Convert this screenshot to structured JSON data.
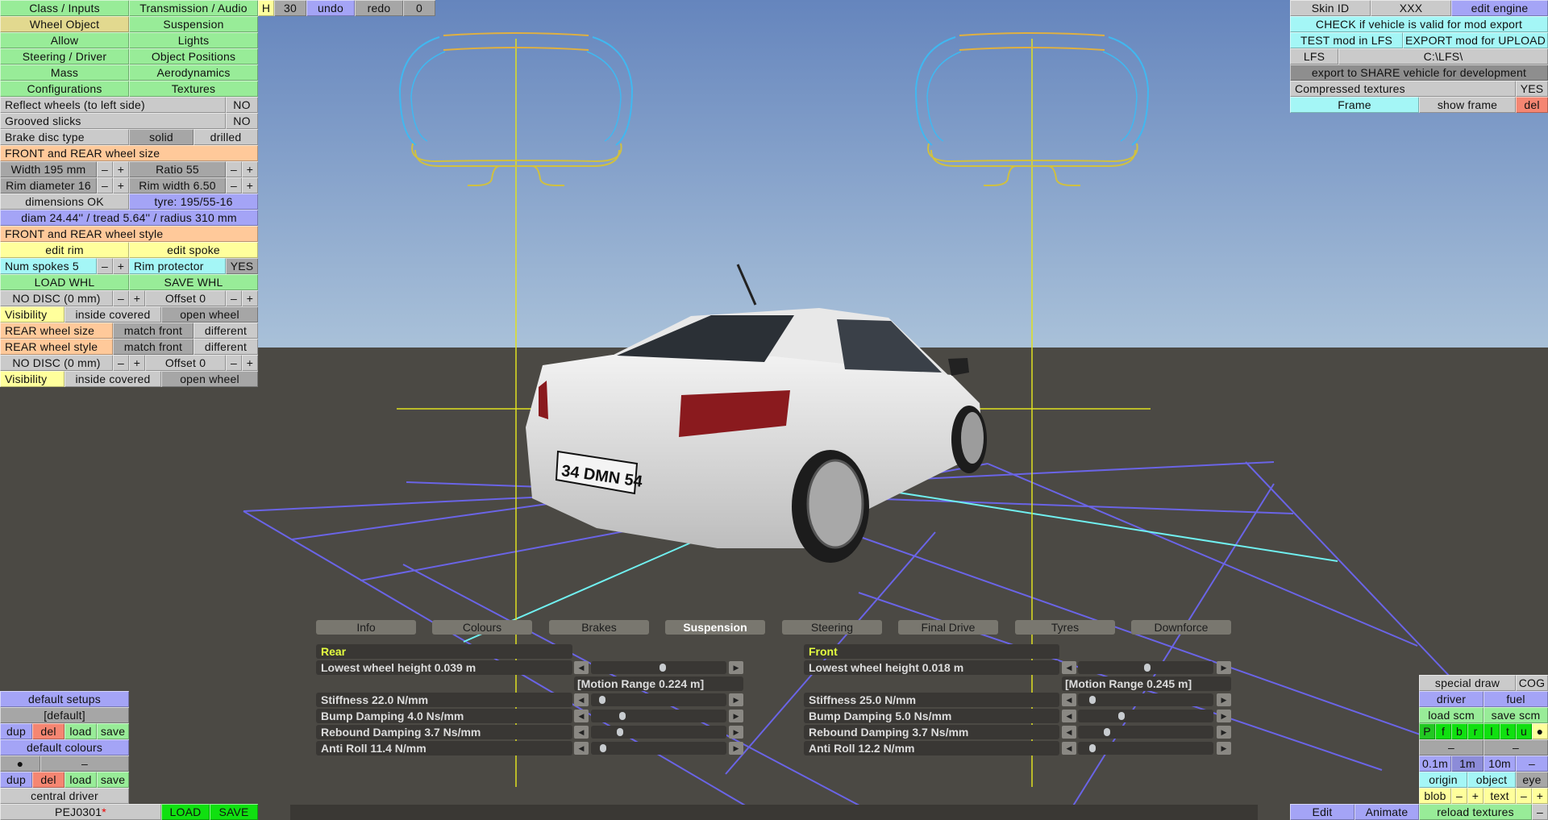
{
  "toolbar": {
    "h": "H",
    "count": "30",
    "undo": "undo",
    "redo": "redo",
    "zero": "0"
  },
  "left_panel": {
    "tabs": [
      "Class / Inputs",
      "Transmission / Audio",
      "Wheel Object",
      "Suspension",
      "Allow",
      "Lights",
      "Steering / Driver",
      "Object Positions",
      "Mass",
      "Aerodynamics",
      "Configurations",
      "Textures"
    ],
    "active_tab": "Wheel Object",
    "reflect": {
      "label": "Reflect wheels (to left side)",
      "value": "NO"
    },
    "grooved": {
      "label": "Grooved slicks",
      "value": "NO"
    },
    "brake_disc": {
      "label": "Brake disc type",
      "solid": "solid",
      "drilled": "drilled",
      "selected": "solid"
    },
    "size_header": "FRONT and REAR wheel size",
    "width": {
      "label": "Width 195 mm",
      "minus": "–",
      "plus": "+"
    },
    "ratio": {
      "label": "Ratio 55",
      "minus": "–",
      "plus": "+"
    },
    "rim_diameter": {
      "label": "Rim diameter 16",
      "minus": "–",
      "plus": "+"
    },
    "rim_width": {
      "label": "Rim width 6.50",
      "minus": "–",
      "plus": "+"
    },
    "dimensions": "dimensions OK",
    "tyre": "tyre: 195/55-16",
    "diam_info": "diam 24.44'' / tread 5.64'' / radius 310 mm",
    "style_header": "FRONT and REAR wheel style",
    "edit_rim": "edit rim",
    "edit_spoke": "edit spoke",
    "num_spokes": {
      "label": "Num spokes 5",
      "minus": "–",
      "plus": "+"
    },
    "rim_protector": {
      "label": "Rim protector",
      "value": "YES"
    },
    "load_whl": "LOAD WHL",
    "save_whl": "SAVE WHL",
    "front_disc": {
      "label": "NO DISC (0 mm)",
      "minus": "–",
      "plus": "+",
      "offset": "Offset 0",
      "offset_minus": "–",
      "offset_plus": "+"
    },
    "front_visibility": {
      "label": "Visibility",
      "inside": "inside covered",
      "open": "open wheel",
      "selected": "open wheel"
    },
    "rear_size": {
      "label": "REAR wheel size",
      "match": "match front",
      "different": "different",
      "selected": "match front"
    },
    "rear_style": {
      "label": "REAR wheel style",
      "match": "match front",
      "different": "different",
      "selected": "match front"
    },
    "rear_disc": {
      "label": "NO DISC (0 mm)",
      "minus": "–",
      "plus": "+",
      "offset": "Offset 0",
      "offset_minus": "–",
      "offset_plus": "+"
    },
    "rear_visibility": {
      "label": "Visibility",
      "inside": "inside covered",
      "open": "open wheel",
      "selected": "open wheel"
    }
  },
  "right_panel": {
    "skin_id": "Skin ID",
    "skin_value": "XXX",
    "edit_engine": "edit engine",
    "check": "CHECK if vehicle is valid for mod export",
    "test": "TEST mod in LFS",
    "export": "EXPORT mod for UPLOAD",
    "lfs": "LFS",
    "path": "C:\\LFS\\",
    "share": "export to SHARE vehicle for development",
    "compressed": {
      "label": "Compressed textures",
      "value": "YES"
    },
    "frame": "Frame",
    "show_frame": "show frame",
    "del": "del"
  },
  "setups_panel": {
    "default_setups": "default setups",
    "setup_name": "[default]",
    "dup": "dup",
    "del": "del",
    "load": "load",
    "save": "save",
    "default_colours": "default colours",
    "colour_dot": "●",
    "colour_dash": "–",
    "central_driver": "central driver",
    "vehicle_name": "PEJ0301",
    "modified_mark": "*",
    "load_upper": "LOAD",
    "save_upper": "SAVE"
  },
  "view_panel": {
    "special_draw": "special draw",
    "cog": "COG",
    "driver": "driver",
    "fuel": "fuel",
    "load_scm": "load scm",
    "save_scm": "save scm",
    "modes": [
      "P",
      "f",
      "b",
      "r",
      "l",
      "t",
      "u",
      "●"
    ],
    "dash1": "–",
    "dash2": "–",
    "grid": [
      "0.1m",
      "1m",
      "10m",
      "–"
    ],
    "origin": "origin",
    "object": "object",
    "eye": "eye",
    "blob": "blob",
    "blob_minus": "–",
    "blob_plus": "+",
    "text": "text",
    "text_minus": "–",
    "text_plus": "+",
    "edit": "Edit",
    "animate": "Animate",
    "reload_textures": "reload textures",
    "reload_dash": "–"
  },
  "vehicle_panel": {
    "tabs": [
      "Info",
      "Colours",
      "Brakes",
      "Suspension",
      "Steering",
      "Final Drive",
      "Tyres",
      "Downforce"
    ],
    "active_tab": "Suspension",
    "rear": {
      "title": "Rear",
      "motion_range": "[Motion Range 0.224 m]",
      "rows": [
        {
          "label": "Lowest wheel height 0.039 m",
          "slider": 0.53
        },
        {
          "label": "Stiffness 22.0 N/mm",
          "slider": 0.065
        },
        {
          "label": "Bump Damping 4.0 Ns/mm",
          "slider": 0.22
        },
        {
          "label": "Rebound Damping 3.7 Ns/mm",
          "slider": 0.2
        },
        {
          "label": "Anti Roll 11.4 N/mm",
          "slider": 0.07
        }
      ]
    },
    "front": {
      "title": "Front",
      "motion_range": "[Motion Range 0.245 m]",
      "rows": [
        {
          "label": "Lowest wheel height 0.018 m",
          "slider": 0.515
        },
        {
          "label": "Stiffness 25.0 N/mm",
          "slider": 0.09
        },
        {
          "label": "Bump Damping 5.0 Ns/mm",
          "slider": 0.31
        },
        {
          "label": "Rebound Damping 3.7 Ns/mm",
          "slider": 0.2
        },
        {
          "label": "Anti Roll 12.2 N/mm",
          "slider": 0.09
        }
      ]
    }
  },
  "scene": {
    "license_plate": "34 DMN 54",
    "sky_top": "#6585bd",
    "sky_horizon": "#a9c1d9",
    "ground": "#4b4944",
    "guide_color": "#e0e020",
    "grid_color": "#6a64e6",
    "axis_color": "#70f0f0"
  }
}
